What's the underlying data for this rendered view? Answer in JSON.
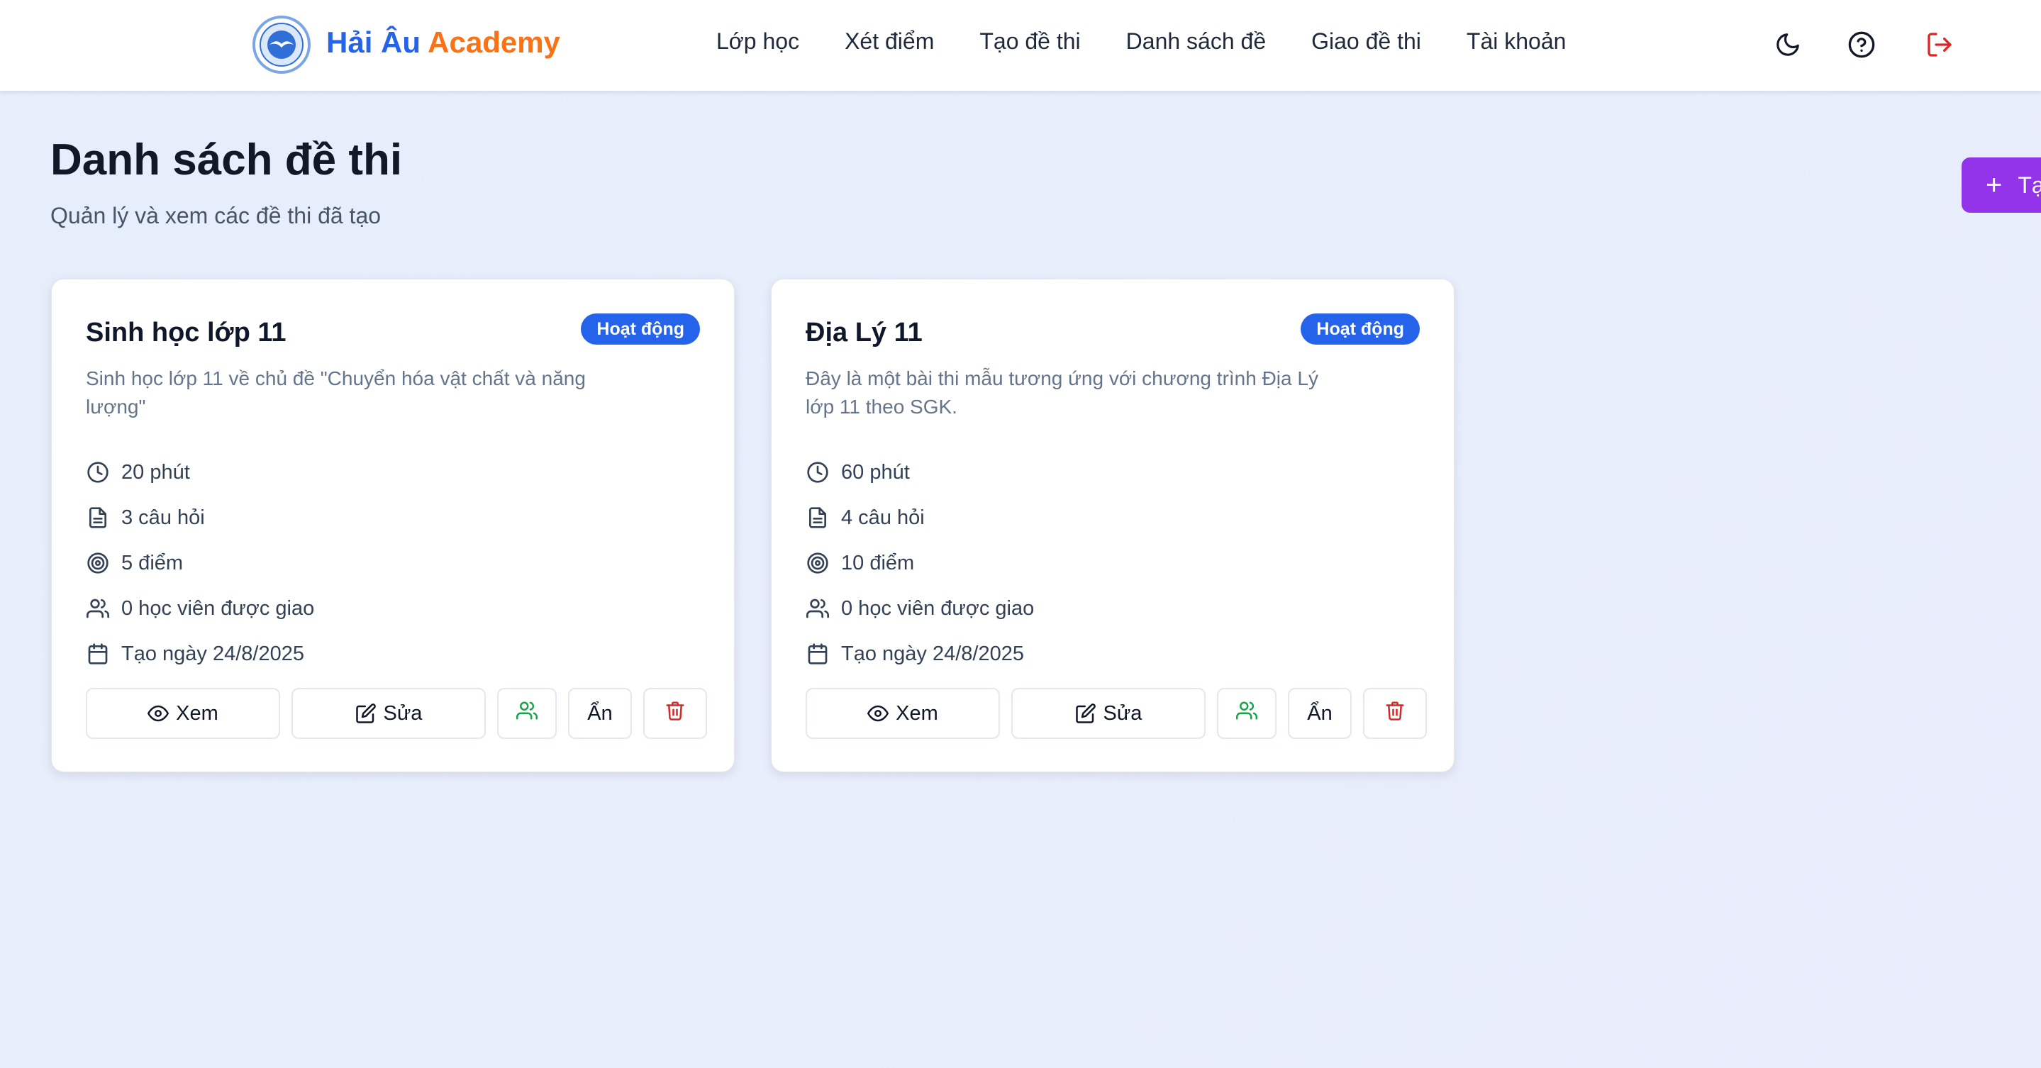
{
  "header": {
    "brand_part1": "Hải Âu",
    "brand_part2": "Academy",
    "nav": [
      {
        "label": "Lớp học"
      },
      {
        "label": "Xét điểm"
      },
      {
        "label": "Tạo đề thi"
      },
      {
        "label": "Danh sách đề"
      },
      {
        "label": "Giao đề thi"
      },
      {
        "label": "Tài khoản"
      }
    ],
    "icons": [
      "moon-icon",
      "help-circle-icon",
      "logout-icon"
    ]
  },
  "page": {
    "title": "Danh sách đề thi",
    "subtitle": "Quản lý và xem các đề thi đã tạo",
    "create_button_label": "Tạ"
  },
  "exams": [
    {
      "title": "Sinh học lớp 11",
      "status": "Hoạt động",
      "description": "Sinh học lớp 11 về chủ đề \"Chuyển hóa vật chất và năng lượng\"",
      "duration": "20 phút",
      "questions": "3 câu hỏi",
      "points": "5 điểm",
      "students": "0 học viên được giao",
      "created": "Tạo ngày 24/8/2025",
      "actions": {
        "view": "Xem",
        "edit": "Sửa",
        "hide": "Ẩn"
      }
    },
    {
      "title": "Địa Lý 11",
      "status": "Hoạt động",
      "description": "Đây là một bài thi mẫu tương ứng với chương trình Địa Lý lớp 11 theo SGK.",
      "duration": "60 phút",
      "questions": "4 câu hỏi",
      "points": "10 điểm",
      "students": "0 học viên được giao",
      "created": "Tạo ngày 24/8/2025",
      "actions": {
        "view": "Xem",
        "edit": "Sửa",
        "hide": "Ẩn"
      }
    }
  ],
  "colors": {
    "brand_blue": "#2563eb",
    "brand_orange": "#f97316",
    "badge": "#2563eb",
    "create_button": "#9333ea",
    "assign_icon": "#16a34a",
    "delete_icon": "#dc2626",
    "logout_icon": "#dc2626"
  }
}
